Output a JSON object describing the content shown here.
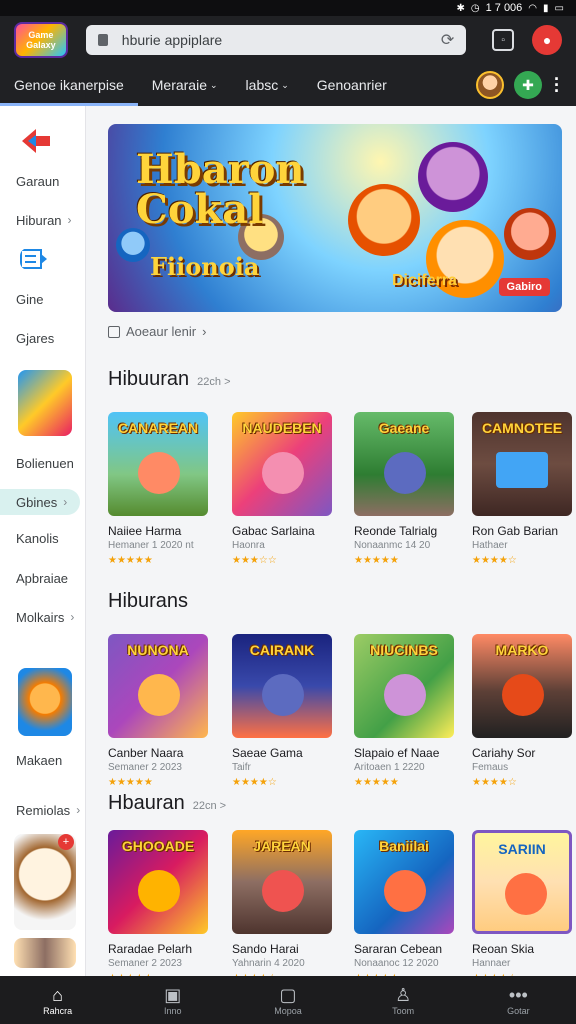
{
  "status": {
    "time": "1 7 006",
    "icons": [
      "bluetooth-icon",
      "alarm-icon",
      "signal-icon",
      "wifi-icon",
      "battery-icon"
    ]
  },
  "topbar": {
    "logo_text": "Game Galaxy",
    "search_value": "hburie appiplare"
  },
  "nav": {
    "tabs": [
      {
        "label": "Genoe ikanerpise",
        "chevron": false
      },
      {
        "label": "Meraraie",
        "chevron": true
      },
      {
        "label": "labsc",
        "chevron": true
      },
      {
        "label": "Genoanrier",
        "chevron": false
      }
    ]
  },
  "sidebar": {
    "items": [
      {
        "label": "Garaun",
        "chevron": false
      },
      {
        "label": "Hiburan",
        "chevron": true
      },
      {
        "label": "Gine",
        "chevron": false
      },
      {
        "label": "Gjares",
        "chevron": false
      },
      {
        "label": "Bolienuen",
        "chevron": false
      },
      {
        "label": "Gbines",
        "chevron": true
      },
      {
        "label": "Kanolis",
        "chevron": false
      },
      {
        "label": "Apbraiae",
        "chevron": false
      },
      {
        "label": "Molkairs",
        "chevron": true
      },
      {
        "label": "Makaen",
        "chevron": false
      },
      {
        "label": "Remiolas",
        "chevron": true
      }
    ],
    "active_index": 5
  },
  "hero": {
    "title_line1": "Hbaron",
    "title_line2": "Cokal",
    "subtitle": "Fiionoia",
    "tag": "Diciferra",
    "badge": "Gabiro"
  },
  "sub_link": "Aoeaur lenir",
  "sections": [
    {
      "title": "Hibuuran",
      "more": "22ch >",
      "cards": [
        {
          "thumb": "CANAREAN",
          "name": "Naiiee Harma",
          "meta": "Hemaner 1 2020 nt",
          "rating": 5
        },
        {
          "thumb": "NAUDEBEN",
          "name": "Gabac Sarlaina",
          "meta": "Haonra",
          "rating": 3
        },
        {
          "thumb": "Gaeane",
          "name": "Reonde Talrialg",
          "meta": "Nonaanmc 14 20",
          "rating": 5
        },
        {
          "thumb": "CAMNOTEE",
          "name": "Ron Gab Barian",
          "meta": "Hathaer",
          "rating": 4
        }
      ]
    },
    {
      "title": "Hiburans",
      "more": "",
      "cards": [
        {
          "thumb": "NUNONA",
          "name": "Canber Naara",
          "meta": "Semaner 2 2023",
          "rating": 5
        },
        {
          "thumb": "CAIRANK",
          "name": "Saeae Gama",
          "meta": "Taifr",
          "rating": 4
        },
        {
          "thumb": "NIUCINBS",
          "name": "Slapaio ef Naae",
          "meta": "Aritoaen 1 2220",
          "rating": 5
        },
        {
          "thumb": "MARKO",
          "name": "Cariahy Sor",
          "meta": "Femaus",
          "rating": 4
        }
      ]
    },
    {
      "title": "Hbauran",
      "more": "22cn >",
      "cards": [
        {
          "thumb": "GHOOADE",
          "name": "Raradae Pelarh",
          "meta": "Semaner 2 2023",
          "rating": 5
        },
        {
          "thumb": "JAREAN",
          "name": "Sando Harai",
          "meta": "Yahnarin 4 2020",
          "rating": 4
        },
        {
          "thumb": "Baniilai",
          "name": "Sararan Cebean",
          "meta": "Nonaanoc 12 2020",
          "rating": 5
        },
        {
          "thumb": "SARIIN",
          "name": "Reoan Skia",
          "meta": "Hannaer",
          "rating": 4
        }
      ]
    }
  ],
  "bottom_nav": [
    {
      "label": "Rahcra",
      "icon": "home-icon"
    },
    {
      "label": "Inno",
      "icon": "store-icon"
    },
    {
      "label": "Mopoa",
      "icon": "bag-icon"
    },
    {
      "label": "Toom",
      "icon": "profile-icon"
    },
    {
      "label": "Gotar",
      "icon": "more-icon"
    }
  ],
  "colors": {
    "topbar": "#202124",
    "accent": "#8ab4f8",
    "active_side": "#d9f1ef",
    "star": "#f4a20b",
    "rec": "#e53935",
    "green": "#34a853"
  }
}
